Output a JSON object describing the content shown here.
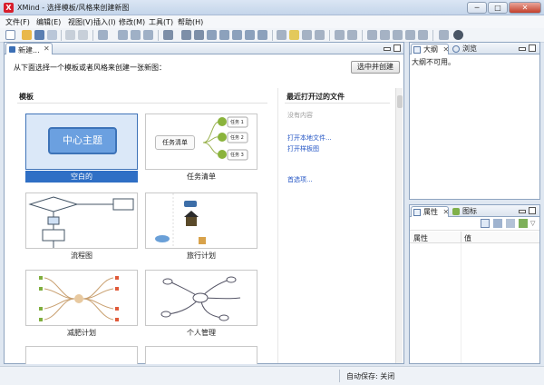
{
  "window": {
    "app_icon": "X",
    "title": "XMind - 选择模板/风格来创建新图",
    "controls": {
      "minimize": "─",
      "maximize": "□",
      "close": "✕"
    }
  },
  "menu": [
    "文件(F)",
    "编辑(E)",
    "视图(V)",
    "插入(I)",
    "修改(M)",
    "工具(T)",
    "帮助(H)"
  ],
  "editor": {
    "tab_label": "新建...",
    "tab_close": "✕",
    "instruction": "从下面选择一个模板或者风格来创建一张新图：",
    "create_button": "选中并创建",
    "templates_header": "模板",
    "templates": [
      {
        "label": "空白的",
        "thumb_text": "中心主题",
        "selected": true
      },
      {
        "label": "任务清单",
        "thumb_text": "任务清单",
        "items": [
          "任务 1",
          "任务 2",
          "任务 3"
        ]
      },
      {
        "label": "流程图"
      },
      {
        "label": "旅行计划"
      },
      {
        "label": "减肥计划"
      },
      {
        "label": "个人管理"
      }
    ],
    "recent": {
      "header": "最近打开过的文件",
      "empty": "没有内容",
      "links": [
        "打开本地文件...",
        "打开样板图"
      ],
      "prefs": "首选项..."
    }
  },
  "outline_panel": {
    "tabs": [
      "大纲",
      "浏览"
    ],
    "tab_close": "✕",
    "message": "大纲不可用。"
  },
  "properties_panel": {
    "tabs": [
      "属性",
      "图标"
    ],
    "tab_close": "✕",
    "columns": [
      "属性",
      "值"
    ]
  },
  "status": {
    "autosave": "自动保存: 关闭"
  },
  "colors": {
    "accent": "#2f6fc5",
    "link": "#2456c5",
    "brand": "#d81e2c"
  }
}
